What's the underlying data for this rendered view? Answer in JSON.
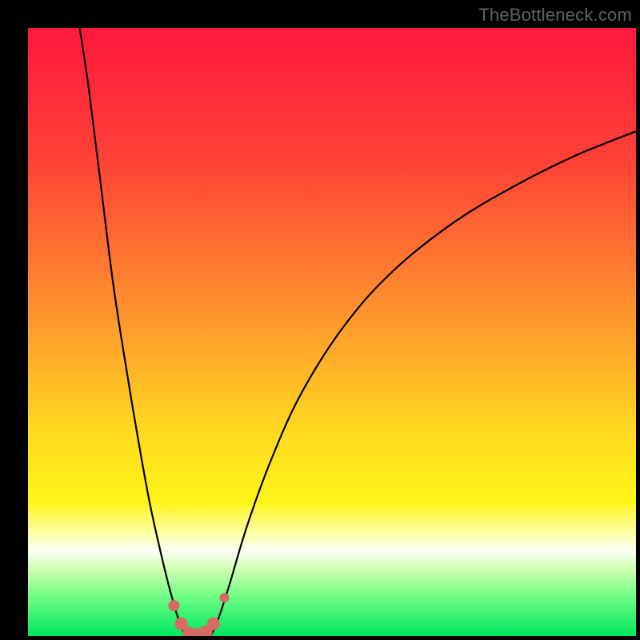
{
  "watermark": "TheBottleneck.com",
  "gradient_stops": [
    {
      "pct": 0,
      "color": "#ff183e"
    },
    {
      "pct": 22,
      "color": "#ff4236"
    },
    {
      "pct": 45,
      "color": "#ff8d2e"
    },
    {
      "pct": 66,
      "color": "#ffd820"
    },
    {
      "pct": 78,
      "color": "#fff51a"
    },
    {
      "pct": 83,
      "color": "#fdffa4"
    },
    {
      "pct": 86,
      "color": "#fafff7"
    },
    {
      "pct": 89,
      "color": "#d1ffb2"
    },
    {
      "pct": 93,
      "color": "#78ff87"
    },
    {
      "pct": 100,
      "color": "#00e760"
    }
  ],
  "chart_data": {
    "type": "line",
    "title": "",
    "xlabel": "",
    "ylabel": "",
    "x_range": [
      0,
      100
    ],
    "y_range": [
      0,
      100
    ],
    "curves": {
      "left_branch": [
        {
          "x": 8.5,
          "y": 100
        },
        {
          "x": 10,
          "y": 90
        },
        {
          "x": 12,
          "y": 74
        },
        {
          "x": 14,
          "y": 58
        },
        {
          "x": 16,
          "y": 45
        },
        {
          "x": 18,
          "y": 33
        },
        {
          "x": 20,
          "y": 22
        },
        {
          "x": 22,
          "y": 13
        },
        {
          "x": 23.5,
          "y": 7
        },
        {
          "x": 25,
          "y": 2
        },
        {
          "x": 26,
          "y": 0
        }
      ],
      "right_branch": [
        {
          "x": 30,
          "y": 0
        },
        {
          "x": 31,
          "y": 2
        },
        {
          "x": 33,
          "y": 8
        },
        {
          "x": 36,
          "y": 18
        },
        {
          "x": 40,
          "y": 29
        },
        {
          "x": 45,
          "y": 40
        },
        {
          "x": 52,
          "y": 51
        },
        {
          "x": 60,
          "y": 60
        },
        {
          "x": 70,
          "y": 68
        },
        {
          "x": 80,
          "y": 74
        },
        {
          "x": 90,
          "y": 79
        },
        {
          "x": 100,
          "y": 83
        }
      ]
    },
    "markers": [
      {
        "x": 24.0,
        "y": 5.0,
        "r": 7
      },
      {
        "x": 25.2,
        "y": 2.0,
        "r": 8
      },
      {
        "x": 26.5,
        "y": 0.5,
        "r": 8
      },
      {
        "x": 28.0,
        "y": 0.3,
        "r": 8
      },
      {
        "x": 29.3,
        "y": 0.7,
        "r": 8
      },
      {
        "x": 30.5,
        "y": 2.0,
        "r": 8
      },
      {
        "x": 32.3,
        "y": 6.3,
        "r": 6
      }
    ],
    "marker_color": "#d86a64",
    "curve_color": "#000000",
    "curve_width": 2.2
  }
}
